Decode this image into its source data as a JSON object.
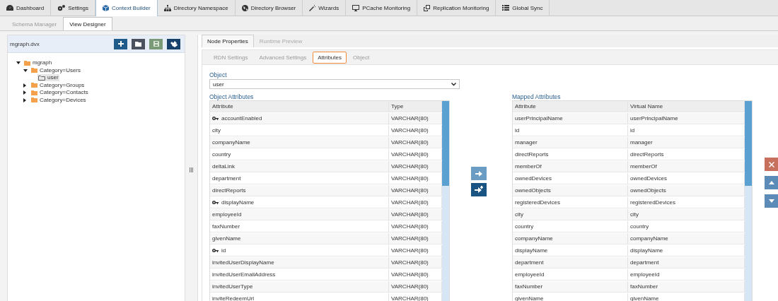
{
  "nav_tabs": [
    {
      "label": "Dashboard",
      "selected": false
    },
    {
      "label": "Settings",
      "selected": false
    },
    {
      "label": "Context Builder",
      "selected": true
    },
    {
      "label": "Directory Namespace",
      "selected": false
    },
    {
      "label": "Directory Browser",
      "selected": false
    },
    {
      "label": "Wizards",
      "selected": false
    },
    {
      "label": "PCache Monitoring",
      "selected": false
    },
    {
      "label": "Replication Monitoring",
      "selected": false
    },
    {
      "label": "Global Sync",
      "selected": false
    }
  ],
  "sub_tabs": [
    {
      "label": "Schema Manager",
      "selected": false
    },
    {
      "label": "View Designer",
      "selected": true
    }
  ],
  "sidebar": {
    "title": "mgraph.dvx",
    "tree": [
      {
        "label": "mgraph",
        "kind": "folder",
        "expanded": true,
        "selected": false,
        "children": [
          {
            "label": "Category=Users",
            "kind": "folder",
            "expanded": true,
            "selected": false,
            "children": [
              {
                "label": "user",
                "kind": "object",
                "selected": true
              }
            ]
          },
          {
            "label": "Category=Groups",
            "kind": "folder",
            "expanded": false,
            "selected": false
          },
          {
            "label": "Category=Contacts",
            "kind": "folder",
            "expanded": false,
            "selected": false
          },
          {
            "label": "Category=Devices",
            "kind": "folder",
            "expanded": false,
            "selected": false
          }
        ]
      }
    ]
  },
  "panel_tabs": [
    {
      "label": "Node Properties",
      "selected": true
    },
    {
      "label": "Runtime Preview",
      "selected": false
    }
  ],
  "property_tabs": [
    {
      "label": "RDN Settings",
      "selected": false
    },
    {
      "label": "Advanced Settings",
      "selected": false
    },
    {
      "label": "Attributes",
      "selected": true
    },
    {
      "label": "Object",
      "selected": false
    }
  ],
  "object_field": {
    "label": "Object",
    "value": "user"
  },
  "object_attributes": {
    "title": "Object Attributes",
    "columns": [
      "Attribute",
      "Type"
    ],
    "rows": [
      {
        "cells": [
          "accountEnabled",
          "VARCHAR(80)"
        ],
        "key": true
      },
      {
        "cells": [
          "city",
          "VARCHAR(80)"
        ],
        "key": false
      },
      {
        "cells": [
          "companyName",
          "VARCHAR(80)"
        ],
        "key": false
      },
      {
        "cells": [
          "country",
          "VARCHAR(80)"
        ],
        "key": false
      },
      {
        "cells": [
          "deltaLink",
          "VARCHAR(80)"
        ],
        "key": false
      },
      {
        "cells": [
          "department",
          "VARCHAR(80)"
        ],
        "key": false
      },
      {
        "cells": [
          "directReports",
          "VARCHAR(80)"
        ],
        "key": false
      },
      {
        "cells": [
          "displayName",
          "VARCHAR(80)"
        ],
        "key": true
      },
      {
        "cells": [
          "employeeId",
          "VARCHAR(80)"
        ],
        "key": false
      },
      {
        "cells": [
          "faxNumber",
          "VARCHAR(80)"
        ],
        "key": false
      },
      {
        "cells": [
          "givenName",
          "VARCHAR(80)"
        ],
        "key": false
      },
      {
        "cells": [
          "id",
          "VARCHAR(80)"
        ],
        "key": true
      },
      {
        "cells": [
          "invitedUserDisplayName",
          "VARCHAR(80)"
        ],
        "key": false
      },
      {
        "cells": [
          "invitedUserEmailAddress",
          "VARCHAR(80)"
        ],
        "key": false
      },
      {
        "cells": [
          "invitedUserType",
          "VARCHAR(80)"
        ],
        "key": false
      },
      {
        "cells": [
          "inviteRedeemUrl",
          "VARCHAR(80)"
        ],
        "key": false
      }
    ]
  },
  "mapped_attributes": {
    "title": "Mapped Attributes",
    "columns": [
      "Attribute",
      "Virtual Name"
    ],
    "rows": [
      [
        "userPrincipalName",
        "userPrincipalName"
      ],
      [
        "id",
        "id"
      ],
      [
        "manager",
        "manager"
      ],
      [
        "directReports",
        "directReports"
      ],
      [
        "memberOf",
        "memberOf"
      ],
      [
        "ownedDevices",
        "ownedDevices"
      ],
      [
        "ownedObjects",
        "ownedObjects"
      ],
      [
        "registeredDevices",
        "registeredDevices"
      ],
      [
        "city",
        "city"
      ],
      [
        "country",
        "country"
      ],
      [
        "companyName",
        "companyName"
      ],
      [
        "displayName",
        "displayName"
      ],
      [
        "department",
        "department"
      ],
      [
        "employeeId",
        "employeeId"
      ],
      [
        "faxNumber",
        "faxNumber"
      ],
      [
        "givenName",
        "givenName"
      ]
    ]
  }
}
